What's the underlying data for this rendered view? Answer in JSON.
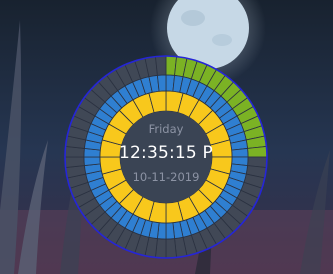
{
  "clock": {
    "day": "Friday",
    "time": "12:35:15 P",
    "date": "10-11-2019"
  },
  "rings": {
    "outer": {
      "segments": 60,
      "filled": 15,
      "fill_color": "#7bb224",
      "empty_color": "#434a58"
    },
    "middle": {
      "segments": 60,
      "filled": 60,
      "fill_color": "#2f7fd1",
      "empty_color": "#434a58"
    },
    "inner": {
      "segments": 24,
      "filled": 24,
      "fill_color": "#f8c81c",
      "empty_color": "#434a58"
    }
  },
  "colors": {
    "border": "#2525d8",
    "center": "#3a4454",
    "moon": "#c6d8e6"
  }
}
